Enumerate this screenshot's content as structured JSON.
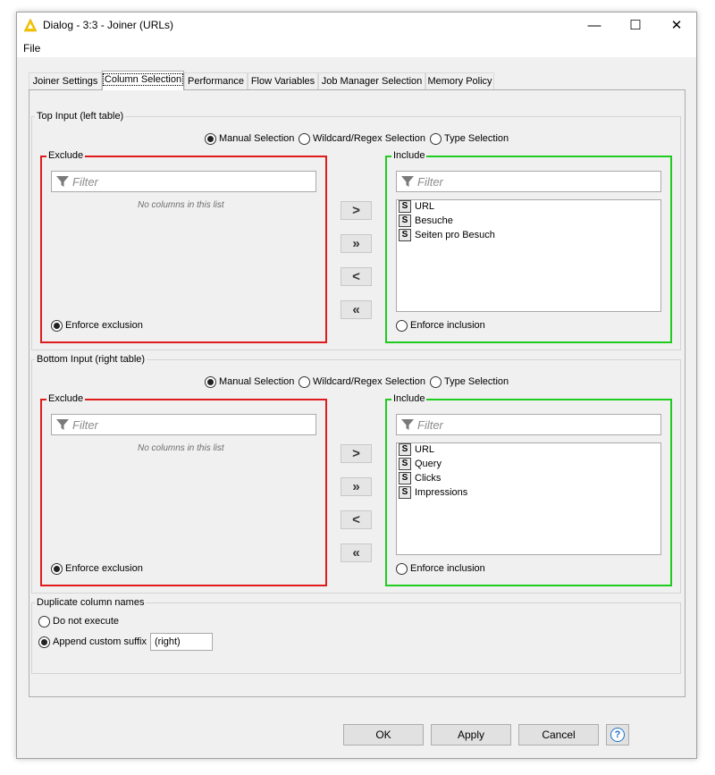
{
  "window": {
    "title": "Dialog - 3:3 - Joiner (URLs)",
    "controls": {
      "minimize": "—",
      "maximize": "☐",
      "close": "✕"
    }
  },
  "menu": {
    "file": "File"
  },
  "tabs": [
    {
      "label": "Joiner Settings"
    },
    {
      "label": "Column Selection"
    },
    {
      "label": "Performance"
    },
    {
      "label": "Flow Variables"
    },
    {
      "label": "Job Manager Selection"
    },
    {
      "label": "Memory Policy"
    }
  ],
  "top_input": {
    "title": "Top Input (left table)",
    "modes": [
      "Manual Selection",
      "Wildcard/Regex Selection",
      "Type Selection"
    ],
    "exclude": {
      "title": "Exclude",
      "filter_placeholder": "Filter",
      "empty_text": "No columns in this list",
      "enforce": "Enforce exclusion"
    },
    "include": {
      "title": "Include",
      "filter_placeholder": "Filter",
      "columns": [
        "URL",
        "Besuche",
        "Seiten pro Besuch"
      ],
      "enforce": "Enforce inclusion"
    }
  },
  "bottom_input": {
    "title": "Bottom Input (right table)",
    "modes": [
      "Manual Selection",
      "Wildcard/Regex Selection",
      "Type Selection"
    ],
    "exclude": {
      "title": "Exclude",
      "filter_placeholder": "Filter",
      "empty_text": "No columns in this list",
      "enforce": "Enforce exclusion"
    },
    "include": {
      "title": "Include",
      "filter_placeholder": "Filter",
      "columns": [
        "URL",
        "Query",
        "Clicks",
        "Impressions"
      ],
      "enforce": "Enforce inclusion"
    }
  },
  "move_buttons": {
    "add": ">",
    "add_all": "»",
    "remove": "<",
    "remove_all": "«"
  },
  "column_type_badge": "S",
  "duplicate": {
    "title": "Duplicate column names",
    "option_no_execute": "Do not execute",
    "option_append": "Append custom suffix",
    "suffix_value": "(right)"
  },
  "buttons": {
    "ok": "OK",
    "apply": "Apply",
    "cancel": "Cancel",
    "help": "?"
  },
  "colors": {
    "exclude_border": "#e01b1b",
    "include_border": "#1ecb1e",
    "help_accent": "#1e73c8"
  }
}
